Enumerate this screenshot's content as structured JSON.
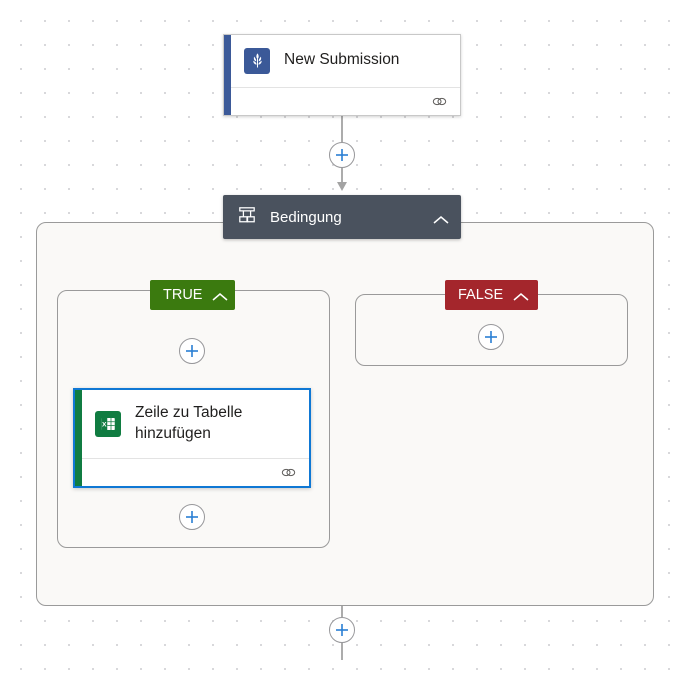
{
  "canvas": {
    "background_color": "#ffffff",
    "grid_dot_color": "#d5d5d8"
  },
  "flow": {
    "trigger": {
      "title": "New Submission",
      "icon": "microsoft-forms-icon",
      "accent_color": "#3b5998",
      "link_icon": "link-icon"
    },
    "condition": {
      "title": "Bedingung",
      "icon": "condition-icon",
      "background_color": "#4a525e",
      "collapse_icon": "chevron-up-icon"
    },
    "branches": [
      {
        "key": "true",
        "label": "TRUE",
        "color": "#3b7a0f",
        "collapse_icon": "chevron-up-icon",
        "actions": [
          {
            "title": "Zeile zu Tabelle hinzufügen",
            "icon": "excel-icon",
            "accent_color": "#107c41",
            "selected": true,
            "selection_color": "#0f78d4",
            "link_icon": "link-icon"
          }
        ]
      },
      {
        "key": "false",
        "label": "FALSE",
        "color": "#a4262c",
        "collapse_icon": "chevron-up-icon",
        "actions": []
      }
    ]
  },
  "add_buttons": {
    "after_trigger": "+",
    "true_before_action": "+",
    "false_branch": "+",
    "true_after_action": "+",
    "after_condition": "+"
  }
}
